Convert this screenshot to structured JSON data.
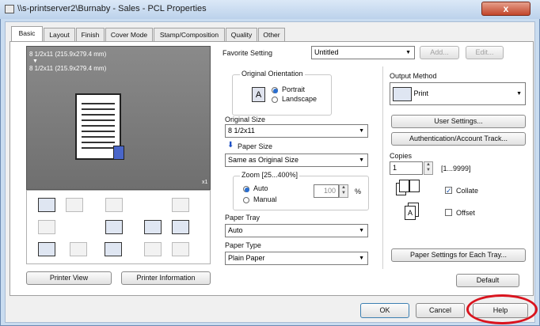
{
  "window": {
    "title": "\\\\s-printserver2\\Burnaby - Sales - PCL Properties",
    "close_label": "x"
  },
  "tabs": [
    "Basic",
    "Layout",
    "Finish",
    "Cover Mode",
    "Stamp/Composition",
    "Quality",
    "Other"
  ],
  "preview": {
    "size_text_1": "8 1/2x11 (215.9x279.4 mm)",
    "size_text_2": "8 1/2x11 (215.9x279.4 mm)",
    "copies_badge": "x1"
  },
  "left_buttons": {
    "printer_view": "Printer View",
    "printer_information": "Printer Information"
  },
  "favorite": {
    "label": "Favorite Setting",
    "value": "Untitled",
    "add": "Add...",
    "edit": "Edit..."
  },
  "orientation": {
    "label": "Original Orientation",
    "portrait": "Portrait",
    "landscape": "Landscape",
    "selected": "Portrait"
  },
  "original_size": {
    "label": "Original Size",
    "value": "8 1/2x11"
  },
  "paper_size": {
    "label": "Paper Size",
    "value": "Same as Original Size"
  },
  "zoom": {
    "label": "Zoom [25...400%]",
    "auto": "Auto",
    "manual": "Manual",
    "value": "100",
    "unit": "%",
    "selected": "Auto"
  },
  "paper_tray": {
    "label": "Paper Tray",
    "value": "Auto"
  },
  "paper_type": {
    "label": "Paper Type",
    "value": "Plain Paper"
  },
  "output_method": {
    "label": "Output Method",
    "value": "Print"
  },
  "right_buttons": {
    "user_settings": "User Settings...",
    "authentication": "Authentication/Account Track...",
    "paper_settings": "Paper Settings for Each Tray...",
    "default": "Default"
  },
  "copies": {
    "label": "Copies",
    "value": "1",
    "range": "[1...9999]",
    "collate": "Collate",
    "collate_checked": true,
    "offset": "Offset",
    "offset_checked": false
  },
  "dialog_buttons": {
    "ok": "OK",
    "cancel": "Cancel",
    "help": "Help"
  },
  "colors": {
    "annotation_circle": "#d9141e",
    "accent": "#2a6fd0"
  }
}
